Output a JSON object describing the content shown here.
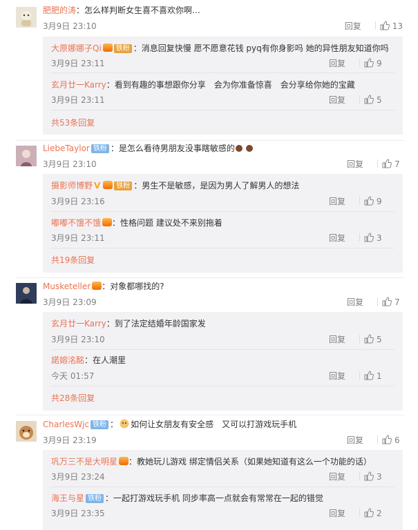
{
  "threads": [
    {
      "user": "肥肥的涛",
      "text": "怎么样判断女生喜不喜欢你啊…",
      "time": "3月9日 23:10",
      "likes": "13",
      "badge": "",
      "vip": false,
      "replies": [
        {
          "user": "大原娜娜子Qi",
          "text": "消息回复快慢 愿不愿意花钱 pyq有你身影吗 她的异性朋友知道你吗",
          "time": "3月9日 23:11",
          "likes": "9",
          "badge": "铁粉",
          "vip": true
        },
        {
          "user": "玄月廿一Karry",
          "text": "看到有趣的事想跟你分享　会为你准备惊喜　会分享给你她的宝藏",
          "time": "3月9日 23:11",
          "likes": "5",
          "badge": "",
          "vip": false
        }
      ],
      "more": "共53条回复"
    },
    {
      "user": "LiebeTaylor",
      "text": "是怎么看待男朋友没事瞎敏感的",
      "time": "3月9日 23:10",
      "likes": "7",
      "badge": "铁粉",
      "vip": false,
      "replies": [
        {
          "user": "摄影师博野",
          "text": "男生不是敏感，是因为男人了解男人的想法",
          "time": "3月9日 23:16",
          "likes": "9",
          "badge": "铁粉",
          "vip": true
        },
        {
          "user": "嘟嘟不饿不饿",
          "text": "性格问题 建议处不来别拖着",
          "time": "3月9日 23:11",
          "likes": "3",
          "badge": "",
          "vip": true
        }
      ],
      "more": "共19条回复"
    },
    {
      "user": "Musketeller",
      "text": "对象都哪找的?",
      "time": "3月9日 23:09",
      "likes": "7",
      "badge": "",
      "vip": true,
      "replies": [
        {
          "user": "玄月廿一Karry",
          "text": "到了法定结婚年龄国家发",
          "time": "3月9日 23:10",
          "likes": "5",
          "badge": "",
          "vip": false
        },
        {
          "user": "諾嫆洺酩",
          "text": "在人潮里",
          "time": "今天 01:57",
          "likes": "1",
          "badge": "",
          "vip": false
        }
      ],
      "more": "共28条回复"
    },
    {
      "user": "CharlesWjc",
      "text": "如何让女朋友有安全感　又可以打游戏玩手机",
      "time": "3月9日 23:19",
      "likes": "6",
      "badge": "铁粉",
      "vip": false,
      "replies": [
        {
          "user": "巩万三不是大明星",
          "text": "教她玩儿游戏 绑定情侣关系（如果她知道有这么一个功能的话）",
          "time": "3月9日 23:24",
          "likes": "3",
          "badge": "",
          "vip": true
        },
        {
          "user": "海王与星",
          "text": "一起打游戏玩手机 同步率高一点就会有常常在一起的错觉",
          "time": "3月9日 23:35",
          "likes": "2",
          "badge": "铁粉",
          "vip": false
        }
      ],
      "more": ""
    }
  ],
  "labels": {
    "reply": "回复"
  }
}
